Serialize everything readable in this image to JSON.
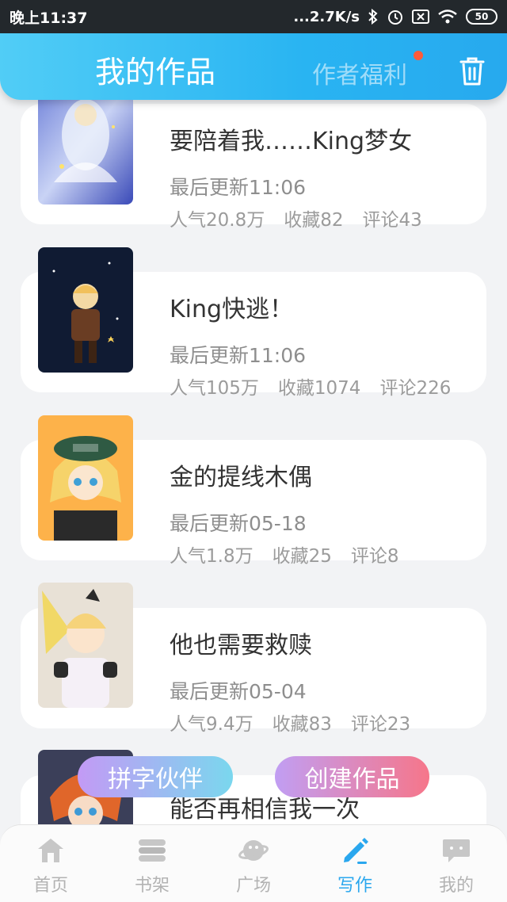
{
  "status": {
    "time": "晚上11:37",
    "speed": "...2.7K/s",
    "battery": "50"
  },
  "header": {
    "title": "我的作品",
    "tab_benefits": "作者福利",
    "accent": "#29b4f2"
  },
  "works": [
    {
      "title": "要陪着我……King梦女",
      "updated": "最后更新11:06",
      "popularity": "人气20.8万",
      "favorites": "收藏82",
      "comments": "评论43"
    },
    {
      "title": "King快逃！",
      "updated": "最后更新11:06",
      "popularity": "人气105万",
      "favorites": "收藏1074",
      "comments": "评论226"
    },
    {
      "title": "金的提线木偶",
      "updated": "最后更新05-18",
      "popularity": "人气1.8万",
      "favorites": "收藏25",
      "comments": "评论8"
    },
    {
      "title": "他也需要救赎",
      "updated": "最后更新05-04",
      "popularity": "人气9.4万",
      "favorites": "收藏83",
      "comments": "评论23"
    },
    {
      "title": "能否再相信我一次"
    }
  ],
  "buttons": {
    "partner": "拼字伙伴",
    "create": "创建作品"
  },
  "nav": {
    "home": "首页",
    "bookshelf": "书架",
    "plaza": "广场",
    "write": "写作",
    "mine": "我的",
    "active_color": "#2aa7ee"
  }
}
